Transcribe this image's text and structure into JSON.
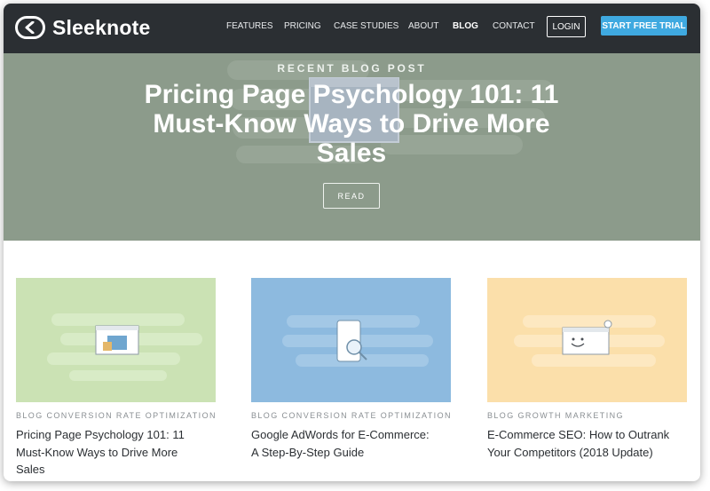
{
  "brand": {
    "name": "Sleeknote",
    "accent": "#3fa9e0",
    "nav_bg": "#2b2f33"
  },
  "nav": {
    "items": [
      {
        "label": "FEATURES"
      },
      {
        "label": "PRICING"
      },
      {
        "label": "CASE STUDIES"
      },
      {
        "label": "ABOUT"
      },
      {
        "label": "BLOG",
        "active": true
      },
      {
        "label": "CONTACT"
      }
    ],
    "login_label": "LOGIN",
    "trial_label": "START FREE TRIAL"
  },
  "hero": {
    "kicker": "RECENT BLOG POST",
    "title": "Pricing Page Psychology 101: 11 Must-Know Ways to Drive More Sales",
    "read_label": "READ",
    "bg_color": "#8c9b8b"
  },
  "posts": [
    {
      "tags": "BLOG CONVERSION RATE OPTIMIZATION",
      "title": "Pricing Page Psychology 101: 11 Must-Know Ways to Drive More Sales",
      "image_color": "#cbe2b4",
      "image_icon": "browser-window-wallet-icon"
    },
    {
      "tags": "BLOG CONVERSION RATE OPTIMIZATION",
      "title": "Google AdWords for E-Commerce: A Step-By-Step Guide",
      "image_color": "#8dbadf",
      "image_icon": "phone-magnifier-icon"
    },
    {
      "tags": "BLOG GROWTH MARKETING",
      "title": "E-Commerce SEO: How to Outrank Your Competitors (2018 Update)",
      "image_color": "#fbdfaa",
      "image_icon": "smiling-browser-window-icon"
    }
  ]
}
